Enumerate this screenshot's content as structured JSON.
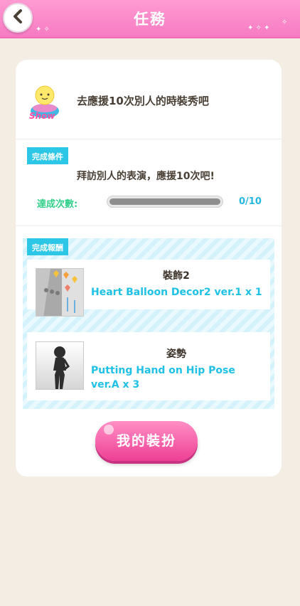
{
  "header": {
    "title": "任務",
    "back_icon": "chevron-left-icon",
    "background": "#f77bc3"
  },
  "quest": {
    "icon_label": "Show",
    "title": "去應援10次別人的時裝秀吧"
  },
  "condition": {
    "tag": "完成條件",
    "text": "拜訪別人的表演，應援10次吧!",
    "count_label": "達成次數:",
    "count_value": "0/10",
    "progress": 0
  },
  "rewards": {
    "tag": "完成報酬",
    "items": [
      {
        "category": "裝飾2",
        "name": "Heart Balloon Decor2 ver.1 x 1"
      },
      {
        "category": "姿勢",
        "name": "Putting Hand on Hip Pose ver.A x 3"
      }
    ]
  },
  "actions": {
    "my_outfit_label": "我的裝扮"
  },
  "colors": {
    "accent_pink": "#ee3f94",
    "accent_cyan": "#2cc6e6",
    "count_green": "#30d08a"
  }
}
